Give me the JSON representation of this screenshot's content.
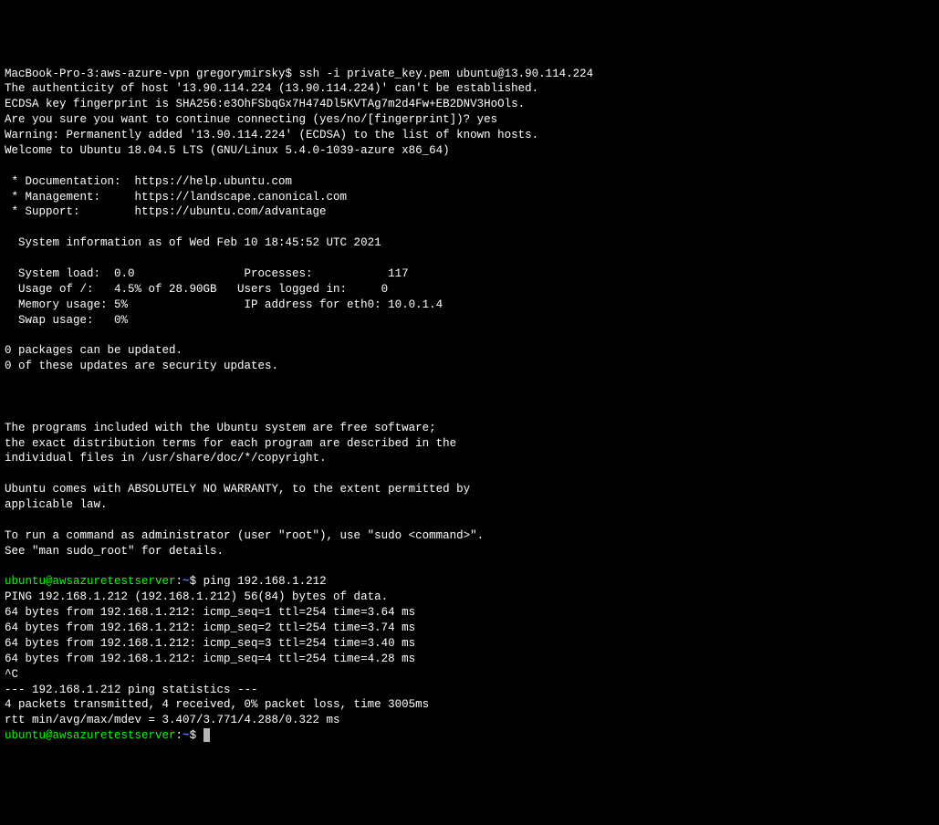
{
  "line1_host": "MacBook-Pro-3:aws-azure-vpn gregorymirsky$",
  "line1_cmd": " ssh -i private_key.pem ubuntu@13.90.114.224",
  "auth1": "The authenticity of host '13.90.114.224 (13.90.114.224)' can't be established.",
  "auth2": "ECDSA key fingerprint is SHA256:e3OhFSbqGx7H474Dl5KVTAg7m2d4Fw+EB2DNV3HoOls.",
  "auth3": "Are you sure you want to continue connecting (yes/no/[fingerprint])? yes",
  "auth4": "Warning: Permanently added '13.90.114.224' (ECDSA) to the list of known hosts.",
  "welcome": "Welcome to Ubuntu 18.04.5 LTS (GNU/Linux 5.4.0-1039-azure x86_64)",
  "doc": " * Documentation:  https://help.ubuntu.com",
  "mgmt": " * Management:     https://landscape.canonical.com",
  "support": " * Support:        https://ubuntu.com/advantage",
  "sysinfo": "  System information as of Wed Feb 10 18:45:52 UTC 2021",
  "load": "  System load:  0.0                Processes:           117",
  "usage": "  Usage of /:   4.5% of 28.90GB   Users logged in:     0",
  "mem": "  Memory usage: 5%                 IP address for eth0: 10.0.1.4",
  "swap": "  Swap usage:   0%",
  "pkgs1": "0 packages can be updated.",
  "pkgs2": "0 of these updates are security updates.",
  "prog1": "The programs included with the Ubuntu system are free software;",
  "prog2": "the exact distribution terms for each program are described in the",
  "prog3": "individual files in /usr/share/doc/*/copyright.",
  "warr1": "Ubuntu comes with ABSOLUTELY NO WARRANTY, to the extent permitted by",
  "warr2": "applicable law.",
  "sudo1": "To run a command as administrator (user \"root\"), use \"sudo <command>\".",
  "sudo2": "See \"man sudo_root\" for details.",
  "prompt_user": "ubuntu@awsazuretestserver",
  "prompt_sep": ":",
  "prompt_path": "~",
  "prompt_end": "$",
  "cmd_ping": " ping 192.168.1.212",
  "ping_hdr": "PING 192.168.1.212 (192.168.1.212) 56(84) bytes of data.",
  "p1": "64 bytes from 192.168.1.212: icmp_seq=1 ttl=254 time=3.64 ms",
  "p2": "64 bytes from 192.168.1.212: icmp_seq=2 ttl=254 time=3.74 ms",
  "p3": "64 bytes from 192.168.1.212: icmp_seq=3 ttl=254 time=3.40 ms",
  "p4": "64 bytes from 192.168.1.212: icmp_seq=4 ttl=254 time=4.28 ms",
  "ctrlc": "^C",
  "stats_hdr": "--- 192.168.1.212 ping statistics ---",
  "stats1": "4 packets transmitted, 4 received, 0% packet loss, time 3005ms",
  "stats2": "rtt min/avg/max/mdev = 3.407/3.771/4.288/0.322 ms"
}
